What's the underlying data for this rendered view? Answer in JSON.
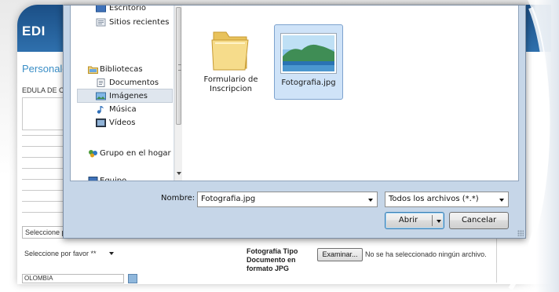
{
  "background_page": {
    "header_text": "EDI",
    "section_title": "Personales",
    "cedula_label": "EDULA DE CIU",
    "select_1_value": "Seleccione po",
    "select_2_value": "Seleccione por favor **",
    "foto_label": "Fotografía Tipo Documento en formato JPG",
    "examinar_label": "Examinar...",
    "no_file_text": "No se ha seleccionado ningún archivo.",
    "country_value": "OLOMBIA"
  },
  "dialog": {
    "nav_items": [
      {
        "label": "Escritorio",
        "icon": "desktop-icon"
      },
      {
        "label": "Sitios recientes",
        "icon": "recent-places-icon"
      },
      {
        "label": "Bibliotecas",
        "icon": "libraries-icon"
      },
      {
        "label": "Documentos",
        "icon": "documents-icon"
      },
      {
        "label": "Imágenes",
        "icon": "pictures-icon",
        "selected": true
      },
      {
        "label": "Música",
        "icon": "music-icon"
      },
      {
        "label": "Vídeos",
        "icon": "videos-icon"
      },
      {
        "label": "Grupo en el hogar",
        "icon": "homegroup-icon"
      },
      {
        "label": "Equipo",
        "icon": "computer-icon"
      }
    ],
    "files": [
      {
        "name": "Formulario de Inscripcion",
        "type": "folder",
        "icon": "folder-icon"
      },
      {
        "name": "Fotografia.jpg",
        "type": "image",
        "icon": "image-thumbnail-icon",
        "selected": true
      }
    ],
    "filename_label": "Nombre:",
    "filename_value": "Fotografia.jpg",
    "filetype_value": "Todos los archivos (*.*)",
    "open_label": "Abrir",
    "cancel_label": "Cancelar"
  },
  "colors": {
    "selection_blue": "#cfe3f8",
    "dialog_chrome": "#c6d6e8",
    "header_blue": "#2f70ad",
    "section_title_blue": "#3a8ec6"
  }
}
